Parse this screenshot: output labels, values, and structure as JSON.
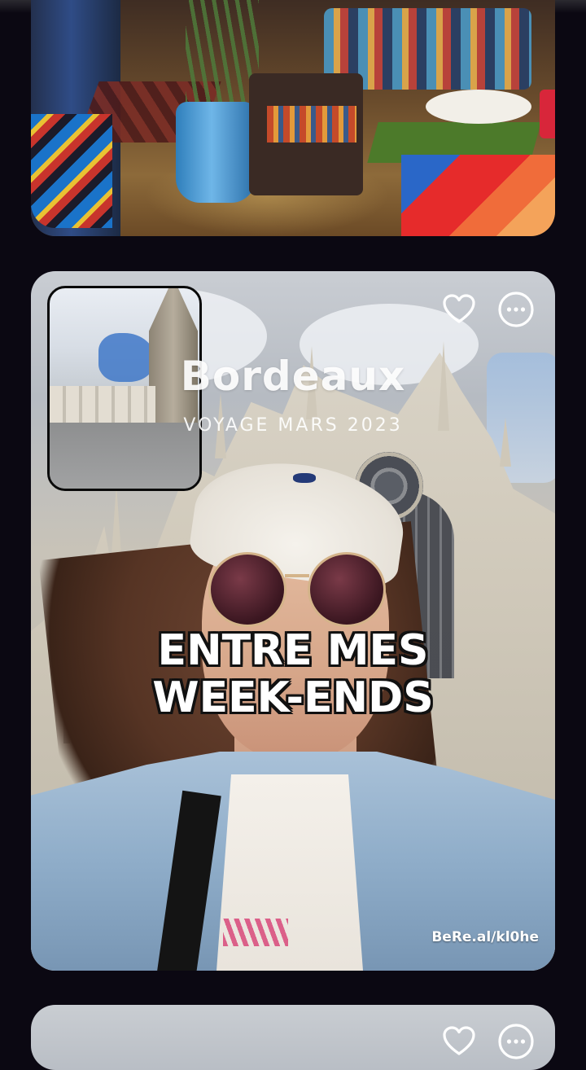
{
  "feed": {
    "post_top": {
      "image": "shop-interior-photo"
    },
    "post_main": {
      "title": "Bordeaux",
      "subtitle": "VOYAGE MARS 2023",
      "caption_line1": "ENTRE MES",
      "caption_line2": "WEEK-ENDS",
      "watermark": "BeRe.al/kl0he",
      "actions": {
        "like_icon": "heart-outline-icon",
        "more_icon": "more-options-icon"
      },
      "front_camera_inset": "square-with-cathedral-tower-photo",
      "back_camera": "selfie-in-front-of-cathedral-photo"
    },
    "post_bottom": {
      "like_icon": "heart-outline-icon",
      "more_icon": "more-options-icon"
    }
  },
  "colors": {
    "background": "#0b0812",
    "overlay_text": "#ffffff",
    "caption_outline": "#111111"
  }
}
